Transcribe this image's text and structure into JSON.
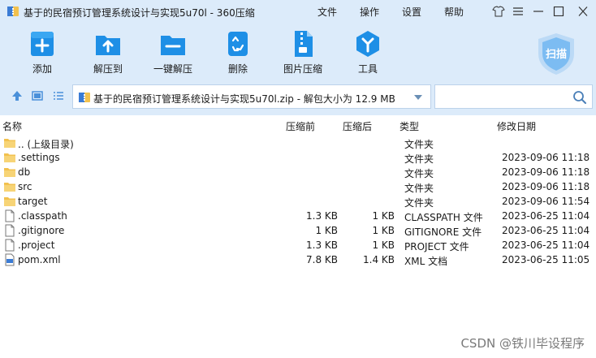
{
  "window": {
    "title": "基于的民宿预订管理系统设计与实现5u70l - 360压缩",
    "menu": [
      "文件",
      "操作",
      "设置",
      "帮助"
    ]
  },
  "toolbar": {
    "add": "添加",
    "extract": "解压到",
    "one_click": "一键解压",
    "delete": "删除",
    "image_compress": "图片压缩",
    "tools": "工具",
    "scan": "扫描"
  },
  "address": {
    "text": "基于的民宿预订管理系统设计与实现5u70l.zip - 解包大小为 12.9 MB"
  },
  "columns": {
    "name": "名称",
    "compressed_before": "压缩前",
    "compressed_after": "压缩后",
    "type": "类型",
    "modified": "修改日期"
  },
  "files": [
    {
      "name": ".. (上级目录)",
      "size": "",
      "packed": "",
      "type": "文件夹",
      "date": "",
      "kind": "folder"
    },
    {
      "name": ".settings",
      "size": "",
      "packed": "",
      "type": "文件夹",
      "date": "2023-09-06 11:18",
      "kind": "folder"
    },
    {
      "name": "db",
      "size": "",
      "packed": "",
      "type": "文件夹",
      "date": "2023-09-06 11:18",
      "kind": "folder"
    },
    {
      "name": "src",
      "size": "",
      "packed": "",
      "type": "文件夹",
      "date": "2023-09-06 11:18",
      "kind": "folder"
    },
    {
      "name": "target",
      "size": "",
      "packed": "",
      "type": "文件夹",
      "date": "2023-09-06 11:54",
      "kind": "folder"
    },
    {
      "name": ".classpath",
      "size": "1.3 KB",
      "packed": "1 KB",
      "type": "CLASSPATH 文件",
      "date": "2023-06-25 11:04",
      "kind": "file"
    },
    {
      "name": ".gitignore",
      "size": "1 KB",
      "packed": "1 KB",
      "type": "GITIGNORE 文件",
      "date": "2023-06-25 11:04",
      "kind": "file"
    },
    {
      "name": ".project",
      "size": "1.3 KB",
      "packed": "1 KB",
      "type": "PROJECT 文件",
      "date": "2023-06-25 11:04",
      "kind": "file"
    },
    {
      "name": "pom.xml",
      "size": "7.8 KB",
      "packed": "1.4 KB",
      "type": "XML 文档",
      "date": "2023-06-25 11:05",
      "kind": "xml"
    }
  ],
  "watermark": "CSDN @铁川毕设程序",
  "colors": {
    "chrome_bg": "#dcebfa",
    "accent_blue": "#1e8fe6",
    "folder_yellow": "#f2c14e"
  }
}
